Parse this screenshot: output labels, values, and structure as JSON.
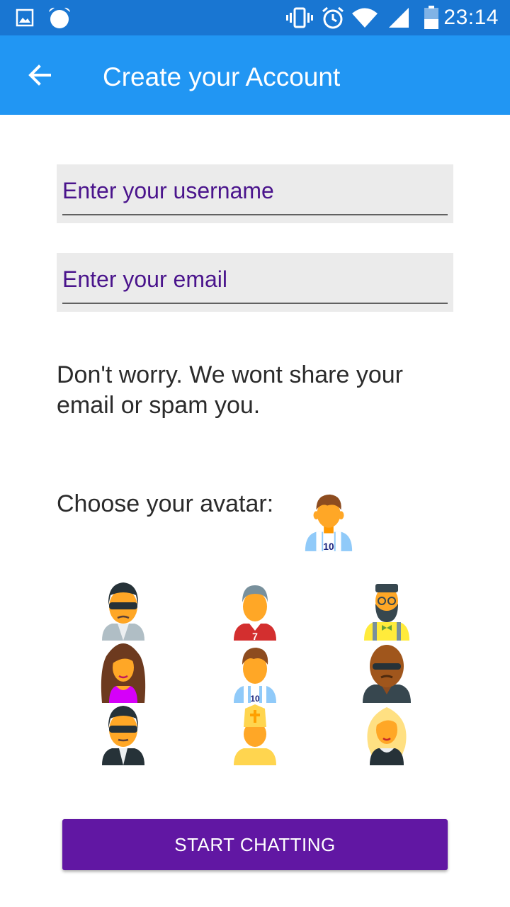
{
  "status_bar": {
    "time": "23:14",
    "icons": [
      "gallery-icon",
      "alarm-icon",
      "vibrate-icon",
      "alarm-clock-icon",
      "wifi-icon",
      "signal-icon",
      "battery-icon"
    ]
  },
  "app_bar": {
    "title": "Create your Account",
    "back_icon": "arrow-back-icon"
  },
  "form": {
    "username_placeholder": "Enter your username",
    "email_placeholder": "Enter your email",
    "info_text": "Don't worry. We wont share your email or spam you.",
    "avatar_label": "Choose your avatar:",
    "start_button": "START CHATTING"
  },
  "avatars": {
    "selected": "footballer-avatar",
    "grid": [
      "agent-avatar",
      "soccer-player-avatar",
      "hipster-avatar",
      "woman-avatar",
      "footballer-avatar",
      "bald-man-sunglasses-avatar",
      "man-sunglasses-avatar",
      "pope-avatar",
      "blonde-woman-avatar"
    ]
  },
  "colors": {
    "status_bar": "#1976D2",
    "app_bar": "#2196F3",
    "input_text": "#4A148C",
    "input_bg": "#EBEBEB",
    "button": "#6117A3"
  }
}
